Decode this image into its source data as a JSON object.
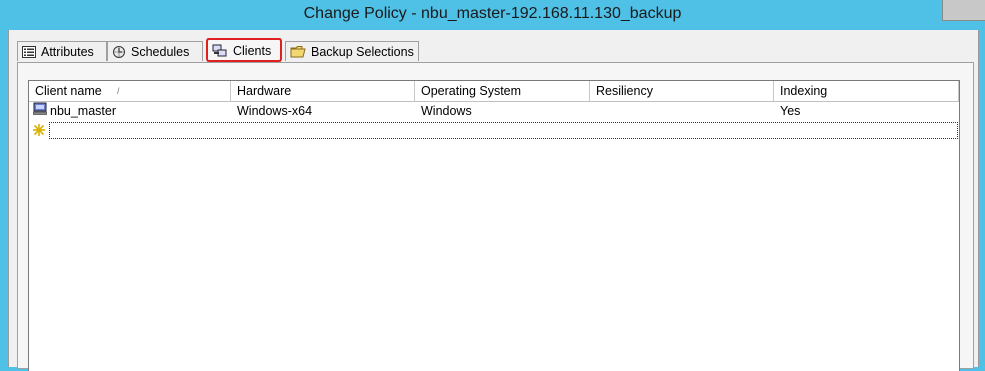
{
  "window": {
    "title": "Change Policy - nbu_master-192.168.11.130_backup"
  },
  "tabs": [
    {
      "label": "Attributes",
      "icon": "list-icon",
      "active": false
    },
    {
      "label": "Schedules",
      "icon": "schedule-icon",
      "active": false
    },
    {
      "label": "Clients",
      "icon": "clients-icon",
      "active": true
    },
    {
      "label": "Backup Selections",
      "icon": "folder-icon",
      "active": false
    }
  ],
  "highlight_color": "#e02020",
  "clients_table": {
    "columns": [
      "Client name",
      "Hardware",
      "Operating System",
      "Resiliency",
      "Indexing"
    ],
    "sorted_by": "Client name",
    "rows": [
      {
        "client_name": "nbu_master",
        "hardware": "Windows-x64",
        "os": "Windows",
        "resiliency": "",
        "indexing": "Yes"
      }
    ],
    "new_row_icon": "new-entry-star-icon"
  }
}
